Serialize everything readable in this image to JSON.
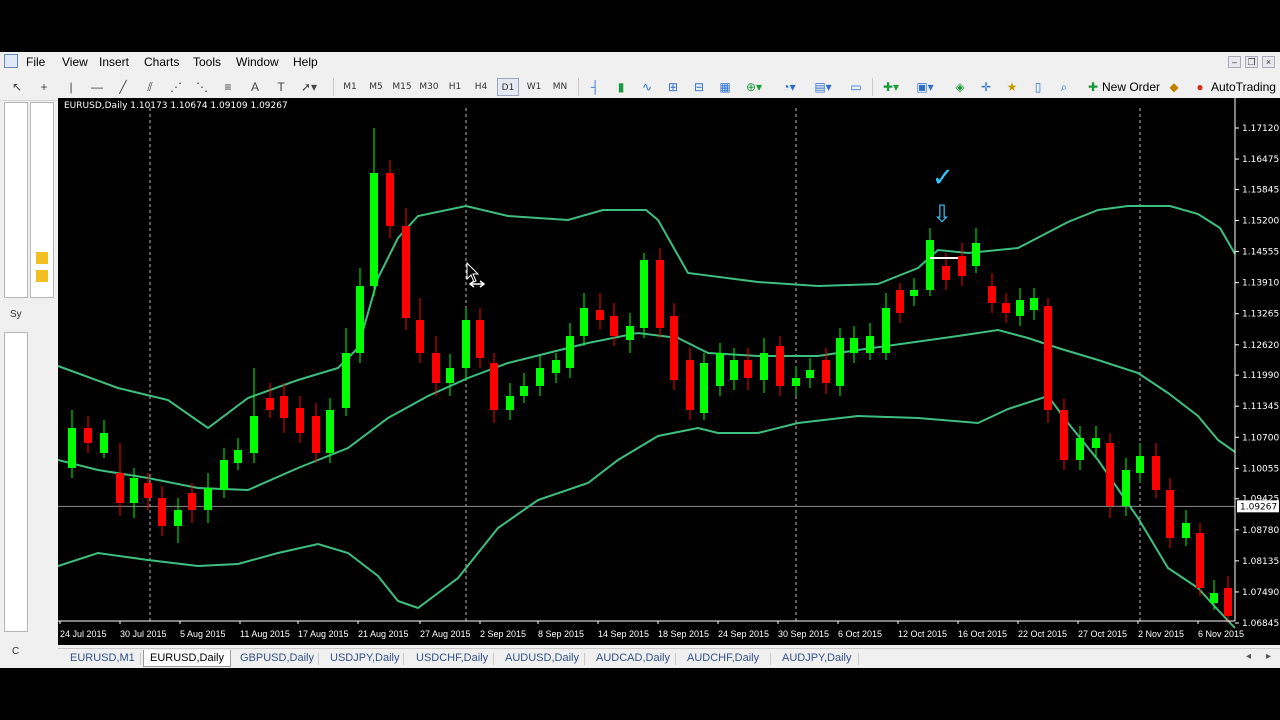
{
  "menu": [
    "File",
    "View",
    "Insert",
    "Charts",
    "Tools",
    "Window",
    "Help"
  ],
  "toolbar": {
    "periods": [
      "M1",
      "M5",
      "M15",
      "M30",
      "H1",
      "H4",
      "D1",
      "W1",
      "MN"
    ],
    "active_period": "D1",
    "new_order_label": "New Order",
    "autotrading_label": "AutoTrading"
  },
  "left_panel": {
    "label_sy": "Sy",
    "label_c": "C"
  },
  "chart": {
    "title": "EURUSD,Daily  1.10173 1.10674 1.09109 1.09267",
    "current_price_label": "1.09267",
    "colors": {
      "bull": "#00ff00",
      "bear": "#ff0000",
      "band": "#3fbf7f",
      "background": "#000000",
      "axis_text": "#ffffff"
    },
    "price_ticks": [
      "1.17120",
      "1.16475",
      "1.15845",
      "1.15200",
      "1.14555",
      "1.13910",
      "1.13265",
      "1.12620",
      "1.11990",
      "1.11345",
      "1.10700",
      "1.10055",
      "1.09425",
      "1.08780",
      "1.08135",
      "1.07490",
      "1.06845"
    ],
    "date_ticks": [
      "24 Jul 2015",
      "30 Jul 2015",
      "5 Aug 2015",
      "11 Aug 2015",
      "17 Aug 2015",
      "21 Aug 2015",
      "27 Aug 2015",
      "2 Sep 2015",
      "8 Sep 2015",
      "14 Sep 2015",
      "18 Sep 2015",
      "24 Sep 2015",
      "30 Sep 2015",
      "6 Oct 2015",
      "12 Oct 2015",
      "16 Oct 2015",
      "22 Oct 2015",
      "27 Oct 2015",
      "2 Nov 2015",
      "6 Nov 2015"
    ],
    "annotations": {
      "check": "✓",
      "arrow": "⇩"
    }
  },
  "tabs": [
    "EURUSD,M1",
    "EURUSD,Daily",
    "GBPUSD,Daily",
    "USDJPY,Daily",
    "USDCHF,Daily",
    "AUDUSD,Daily",
    "AUDCAD,Daily",
    "AUDCHF,Daily",
    "AUDJPY,Daily"
  ],
  "active_tab": "EURUSD,Daily"
}
